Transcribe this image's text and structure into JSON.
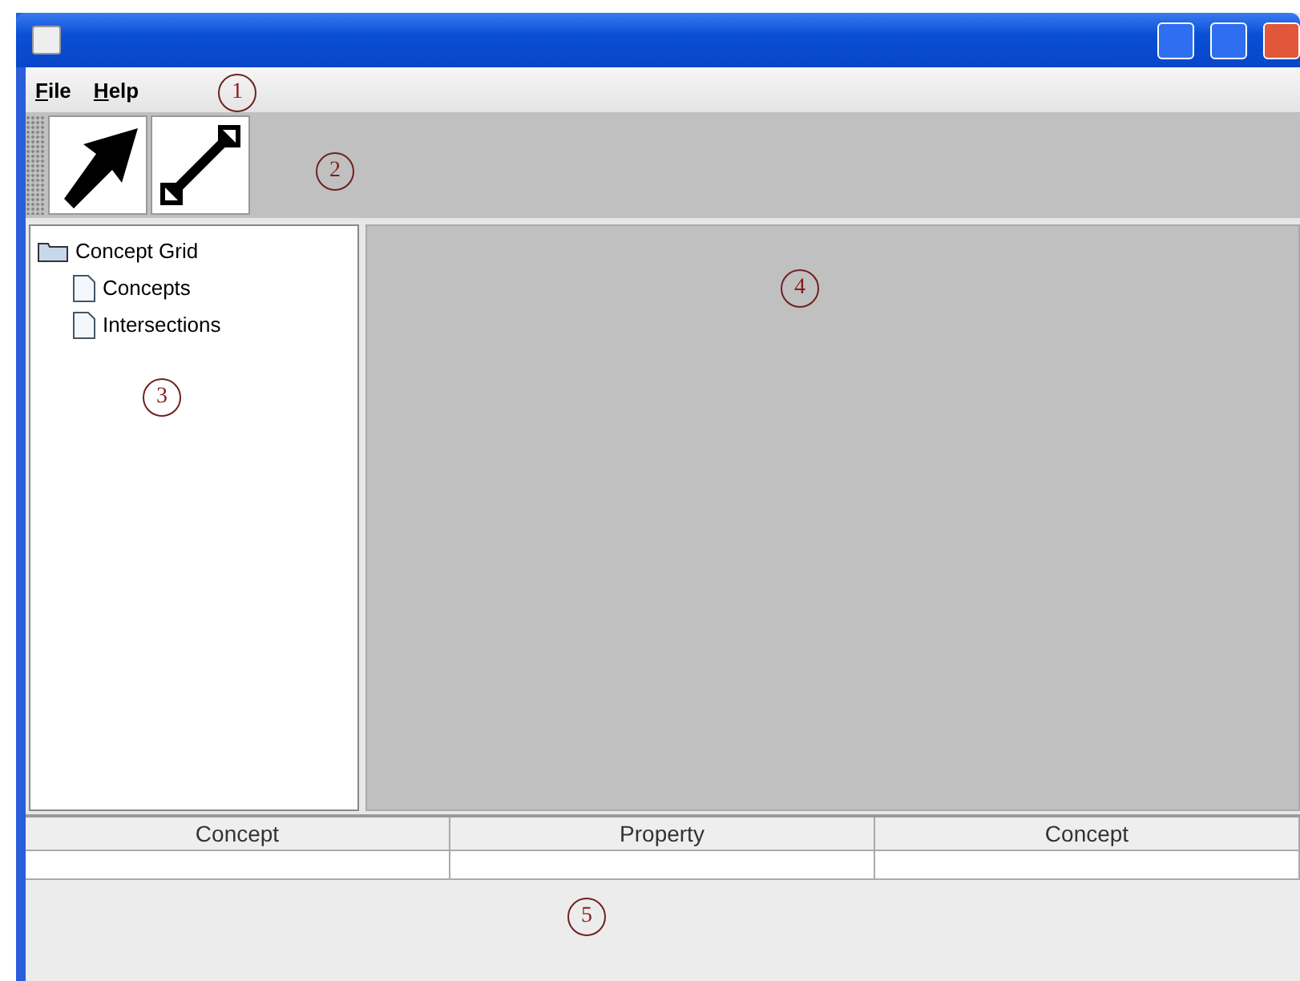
{
  "menu": [
    {
      "label": "File"
    },
    {
      "label": "Help"
    }
  ],
  "toolbar": [
    {
      "kind": "select",
      "selected": false
    },
    {
      "kind": "connect",
      "selected": false
    }
  ],
  "tree": {
    "label": "Concept Grid",
    "expanded": true,
    "children": [
      {
        "label": "Concepts"
      },
      {
        "label": "Intersections"
      }
    ]
  },
  "table": {
    "columns": [
      "Concept",
      "Property",
      "Concept"
    ],
    "rows": [
      [
        "",
        "",
        ""
      ]
    ]
  },
  "callouts": [
    "1",
    "2",
    "3",
    "4",
    "5"
  ]
}
